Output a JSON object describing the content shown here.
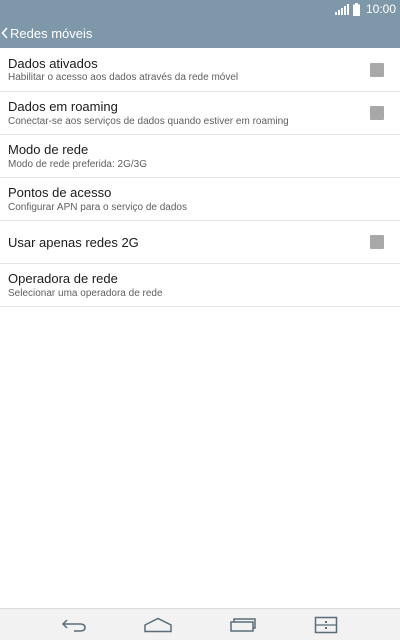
{
  "status_bar": {
    "time": "10:00"
  },
  "header": {
    "title": "Redes móveis"
  },
  "settings": [
    {
      "title": "Dados ativados",
      "summary": "Habilitar o acesso aos dados através da rede móvel",
      "checkbox": true,
      "checked": false
    },
    {
      "title": "Dados em roaming",
      "summary": "Conectar-se aos serviços de dados quando estiver em roaming",
      "checkbox": true,
      "checked": false
    },
    {
      "title": "Modo de rede",
      "summary": "Modo de rede preferida: 2G/3G",
      "checkbox": false
    },
    {
      "title": "Pontos de acesso",
      "summary": "Configurar APN para o serviço de dados",
      "checkbox": false
    },
    {
      "title": "Usar apenas redes 2G",
      "summary": "",
      "checkbox": true,
      "checked": false
    },
    {
      "title": "Operadora de rede",
      "summary": "Selecionar uma operadora de rede",
      "checkbox": false
    }
  ],
  "nav_bar": {
    "buttons": [
      {
        "icon": "back-icon"
      },
      {
        "icon": "home-icon"
      },
      {
        "icon": "recent-apps-icon"
      },
      {
        "icon": "dual-window-icon"
      }
    ]
  },
  "colors": {
    "header_bg": "#7e98a9",
    "checkbox": "#a8a8a8",
    "divider": "#e6e6e6",
    "nav_bg": "#f2f2f2"
  }
}
